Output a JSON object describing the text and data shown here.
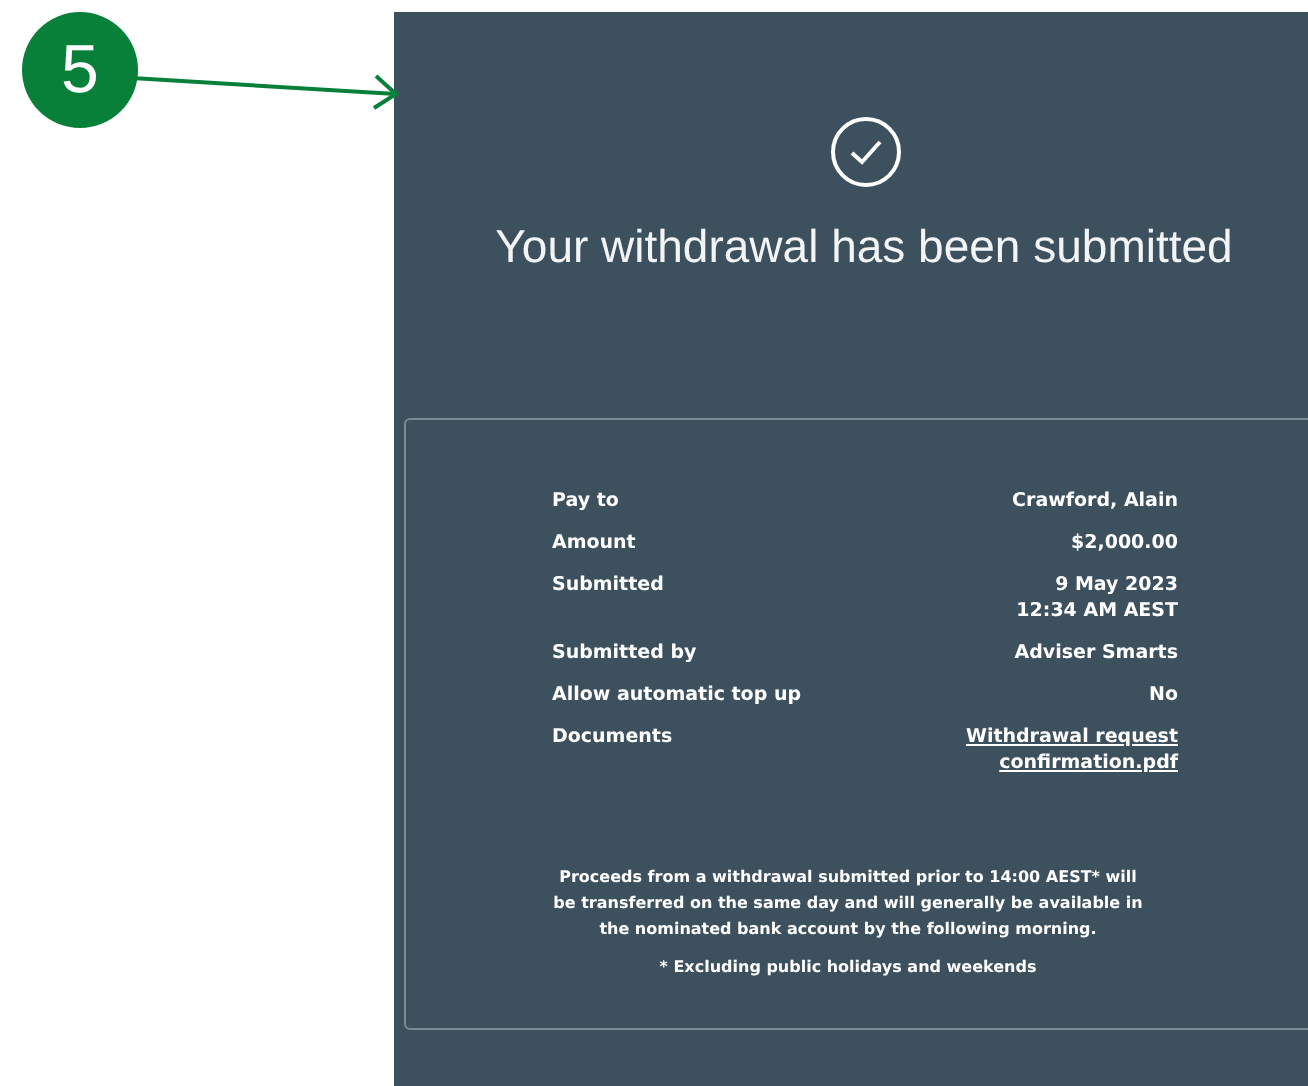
{
  "callout": {
    "number": "5"
  },
  "confirmation": {
    "title": "Your withdrawal has been submitted"
  },
  "details": [
    {
      "label": "Pay to",
      "kind": "text",
      "lines": [
        "Crawford, Alain"
      ]
    },
    {
      "label": "Amount",
      "kind": "text",
      "lines": [
        "$2,000.00"
      ]
    },
    {
      "label": "Submitted",
      "kind": "text",
      "lines": [
        "9 May 2023",
        "12:34 AM AEST"
      ]
    },
    {
      "label": "Submitted by",
      "kind": "text",
      "lines": [
        "Adviser Smarts"
      ]
    },
    {
      "label": "Allow automatic top up",
      "kind": "text",
      "lines": [
        "No"
      ]
    },
    {
      "label": "Documents",
      "kind": "link",
      "lines": [
        "Withdrawal request",
        "confirmation.pdf"
      ]
    }
  ],
  "note": "Proceeds from a withdrawal submitted prior to 14:00 AEST* will be transferred on the same day and will generally be available in the nominated bank account by the following morning.",
  "footnote": "* Excluding public holidays and weekends"
}
